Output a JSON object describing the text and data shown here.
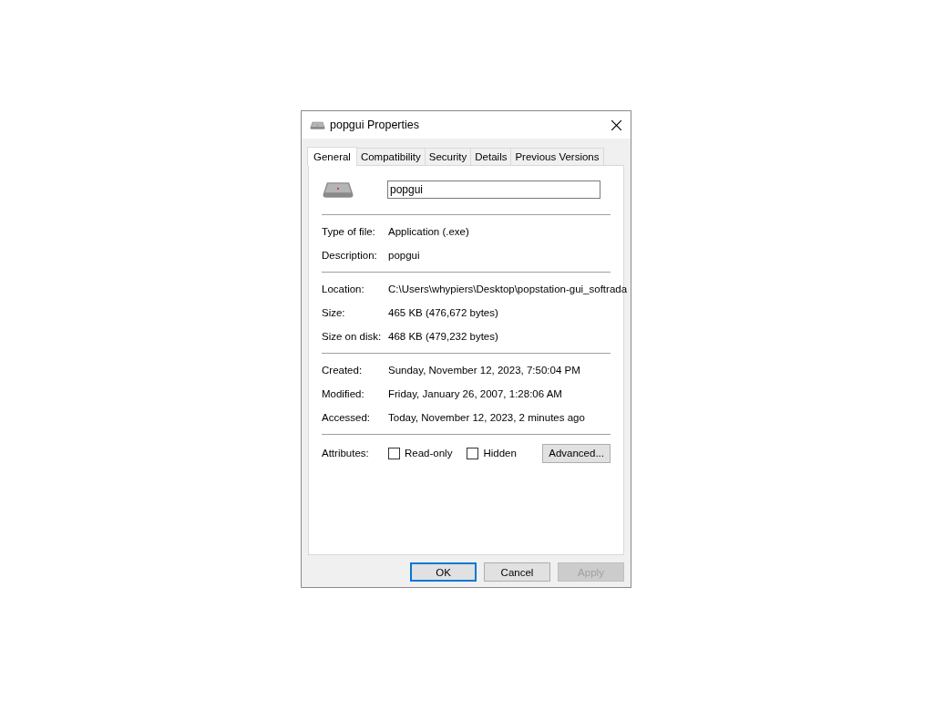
{
  "window": {
    "title": "popgui Properties"
  },
  "tabs": [
    {
      "label": "General",
      "selected": true
    },
    {
      "label": "Compatibility",
      "selected": false
    },
    {
      "label": "Security",
      "selected": false
    },
    {
      "label": "Details",
      "selected": false
    },
    {
      "label": "Previous Versions",
      "selected": false
    }
  ],
  "name_field": {
    "value": "popgui"
  },
  "sections": [
    {
      "rows": [
        {
          "label": "Type of file:",
          "value": "Application (.exe)"
        },
        {
          "label": "Description:",
          "value": "popgui"
        }
      ]
    },
    {
      "rows": [
        {
          "label": "Location:",
          "value": "C:\\Users\\whypiers\\Desktop\\popstation-gui_softrada"
        },
        {
          "label": "Size:",
          "value": "465 KB (476,672 bytes)"
        },
        {
          "label": "Size on disk:",
          "value": "468 KB (479,232 bytes)"
        }
      ]
    },
    {
      "rows": [
        {
          "label": "Created:",
          "value": "Sunday, November 12, 2023, 7:50:04 PM"
        },
        {
          "label": "Modified:",
          "value": "Friday, January 26, 2007, 1:28:06 AM"
        },
        {
          "label": "Accessed:",
          "value": "Today, November 12, 2023, 2 minutes ago"
        }
      ]
    }
  ],
  "attributes": {
    "label": "Attributes:",
    "checkboxes": [
      {
        "label": "Read-only",
        "checked": false
      },
      {
        "label": "Hidden",
        "checked": false
      }
    ],
    "advanced_button": "Advanced..."
  },
  "buttons": [
    {
      "label": "OK",
      "default": true,
      "disabled": false
    },
    {
      "label": "Cancel",
      "default": false,
      "disabled": false
    },
    {
      "label": "Apply",
      "default": false,
      "disabled": true
    }
  ]
}
